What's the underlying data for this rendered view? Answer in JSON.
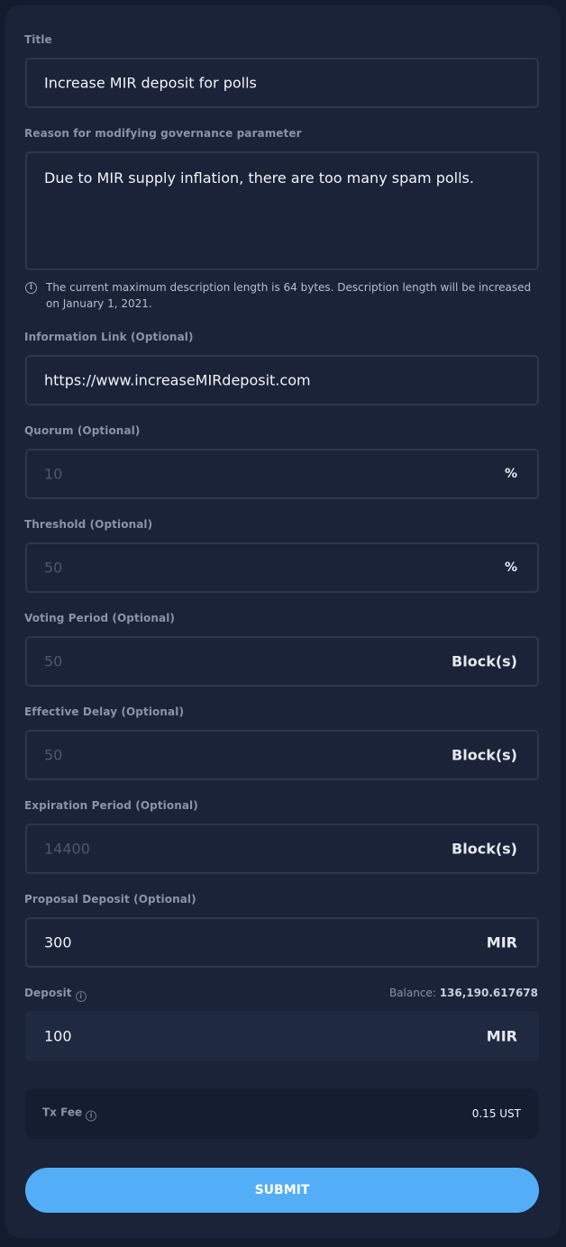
{
  "form": {
    "title": {
      "label": "Title",
      "value": "Increase MIR deposit for polls"
    },
    "reason": {
      "label": "Reason for modifying governance parameter",
      "value": "Due to MIR supply inflation, there are too many spam polls."
    },
    "info_note": "The current maximum description length is 64 bytes. Description length will be increased on January 1, 2021.",
    "info_link": {
      "label": "Information Link (Optional)",
      "value": "https://www.increaseMIRdeposit.com"
    },
    "quorum": {
      "label": "Quorum (Optional)",
      "placeholder": "10",
      "unit": "%"
    },
    "threshold": {
      "label": "Threshold (Optional)",
      "placeholder": "50",
      "unit": "%"
    },
    "voting_period": {
      "label": "Voting Period (Optional)",
      "placeholder": "50",
      "unit": "Block(s)"
    },
    "effective_delay": {
      "label": "Effective Delay (Optional)",
      "placeholder": "50",
      "unit": "Block(s)"
    },
    "expiration_period": {
      "label": "Expiration Period (Optional)",
      "placeholder": "14400",
      "unit": "Block(s)"
    },
    "proposal_deposit": {
      "label": "Proposal Deposit (Optional)",
      "value": "300",
      "unit": "MIR"
    },
    "deposit": {
      "label": "Deposit",
      "value": "100",
      "unit": "MIR",
      "balance_label": "Balance:",
      "balance_value": "136,190.617678"
    },
    "tx_fee": {
      "label": "Tx Fee",
      "value": "0.15 UST"
    },
    "submit_label": "SUBMIT"
  },
  "icons": {
    "info": "info-icon"
  },
  "colors": {
    "accent": "#54aef7",
    "background": "#1b2338"
  }
}
